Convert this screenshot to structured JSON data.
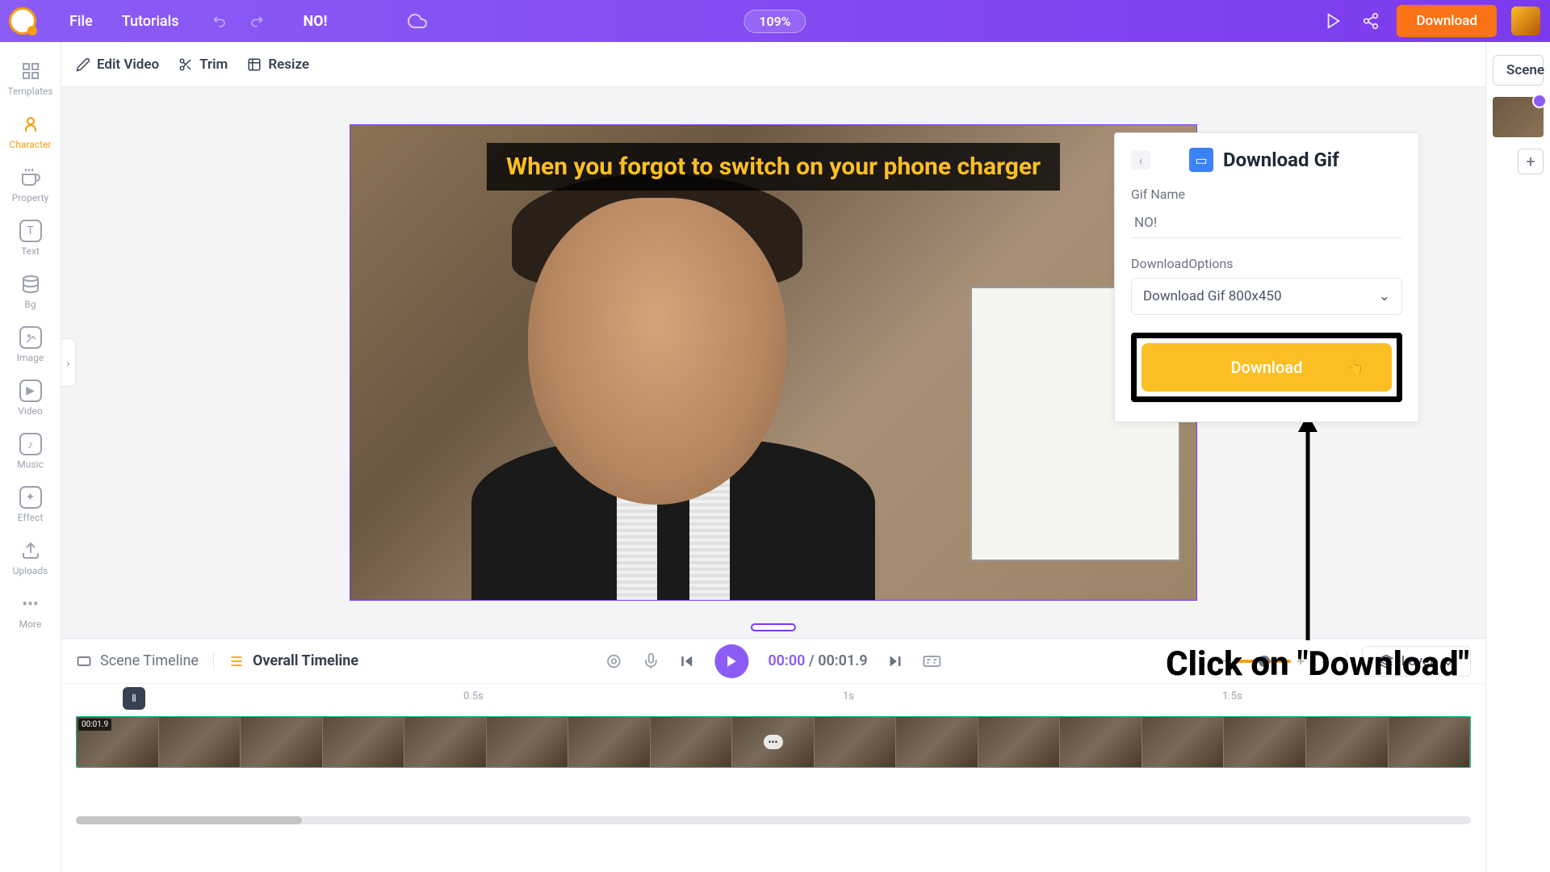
{
  "topbar": {
    "menu_file": "File",
    "menu_tutorials": "Tutorials",
    "project_title": "NO!",
    "zoom": "109%",
    "download_label": "Download"
  },
  "sidebar": {
    "items": [
      {
        "label": "Templates"
      },
      {
        "label": "Character"
      },
      {
        "label": "Property"
      },
      {
        "label": "Text"
      },
      {
        "label": "Bg"
      },
      {
        "label": "Image"
      },
      {
        "label": "Video"
      },
      {
        "label": "Music"
      },
      {
        "label": "Effect"
      },
      {
        "label": "Uploads"
      },
      {
        "label": "More"
      }
    ]
  },
  "toolbar": {
    "edit": "Edit Video",
    "trim": "Trim",
    "resize": "Resize"
  },
  "canvas": {
    "overlay_text": "When you forgot to switch on your phone charger"
  },
  "right": {
    "scene_label": "Scene"
  },
  "panel": {
    "title": "Download Gif",
    "gif_name_label": "Gif Name",
    "gif_name_value": "NO!",
    "options_label": "DownloadOptions",
    "option_selected": "Download Gif 800x450",
    "download_action": "Download"
  },
  "annotation": {
    "text": "Click on \"Download\""
  },
  "timeline": {
    "scene_tab": "Scene Timeline",
    "overall_tab": "Overall Timeline",
    "time_current": "00:00",
    "time_sep": " / ",
    "time_total": "00:01.9",
    "layer_label": "Layer",
    "marks": [
      "0.5s",
      "1s",
      "1.5s"
    ],
    "clip_duration": "00:01.9"
  }
}
